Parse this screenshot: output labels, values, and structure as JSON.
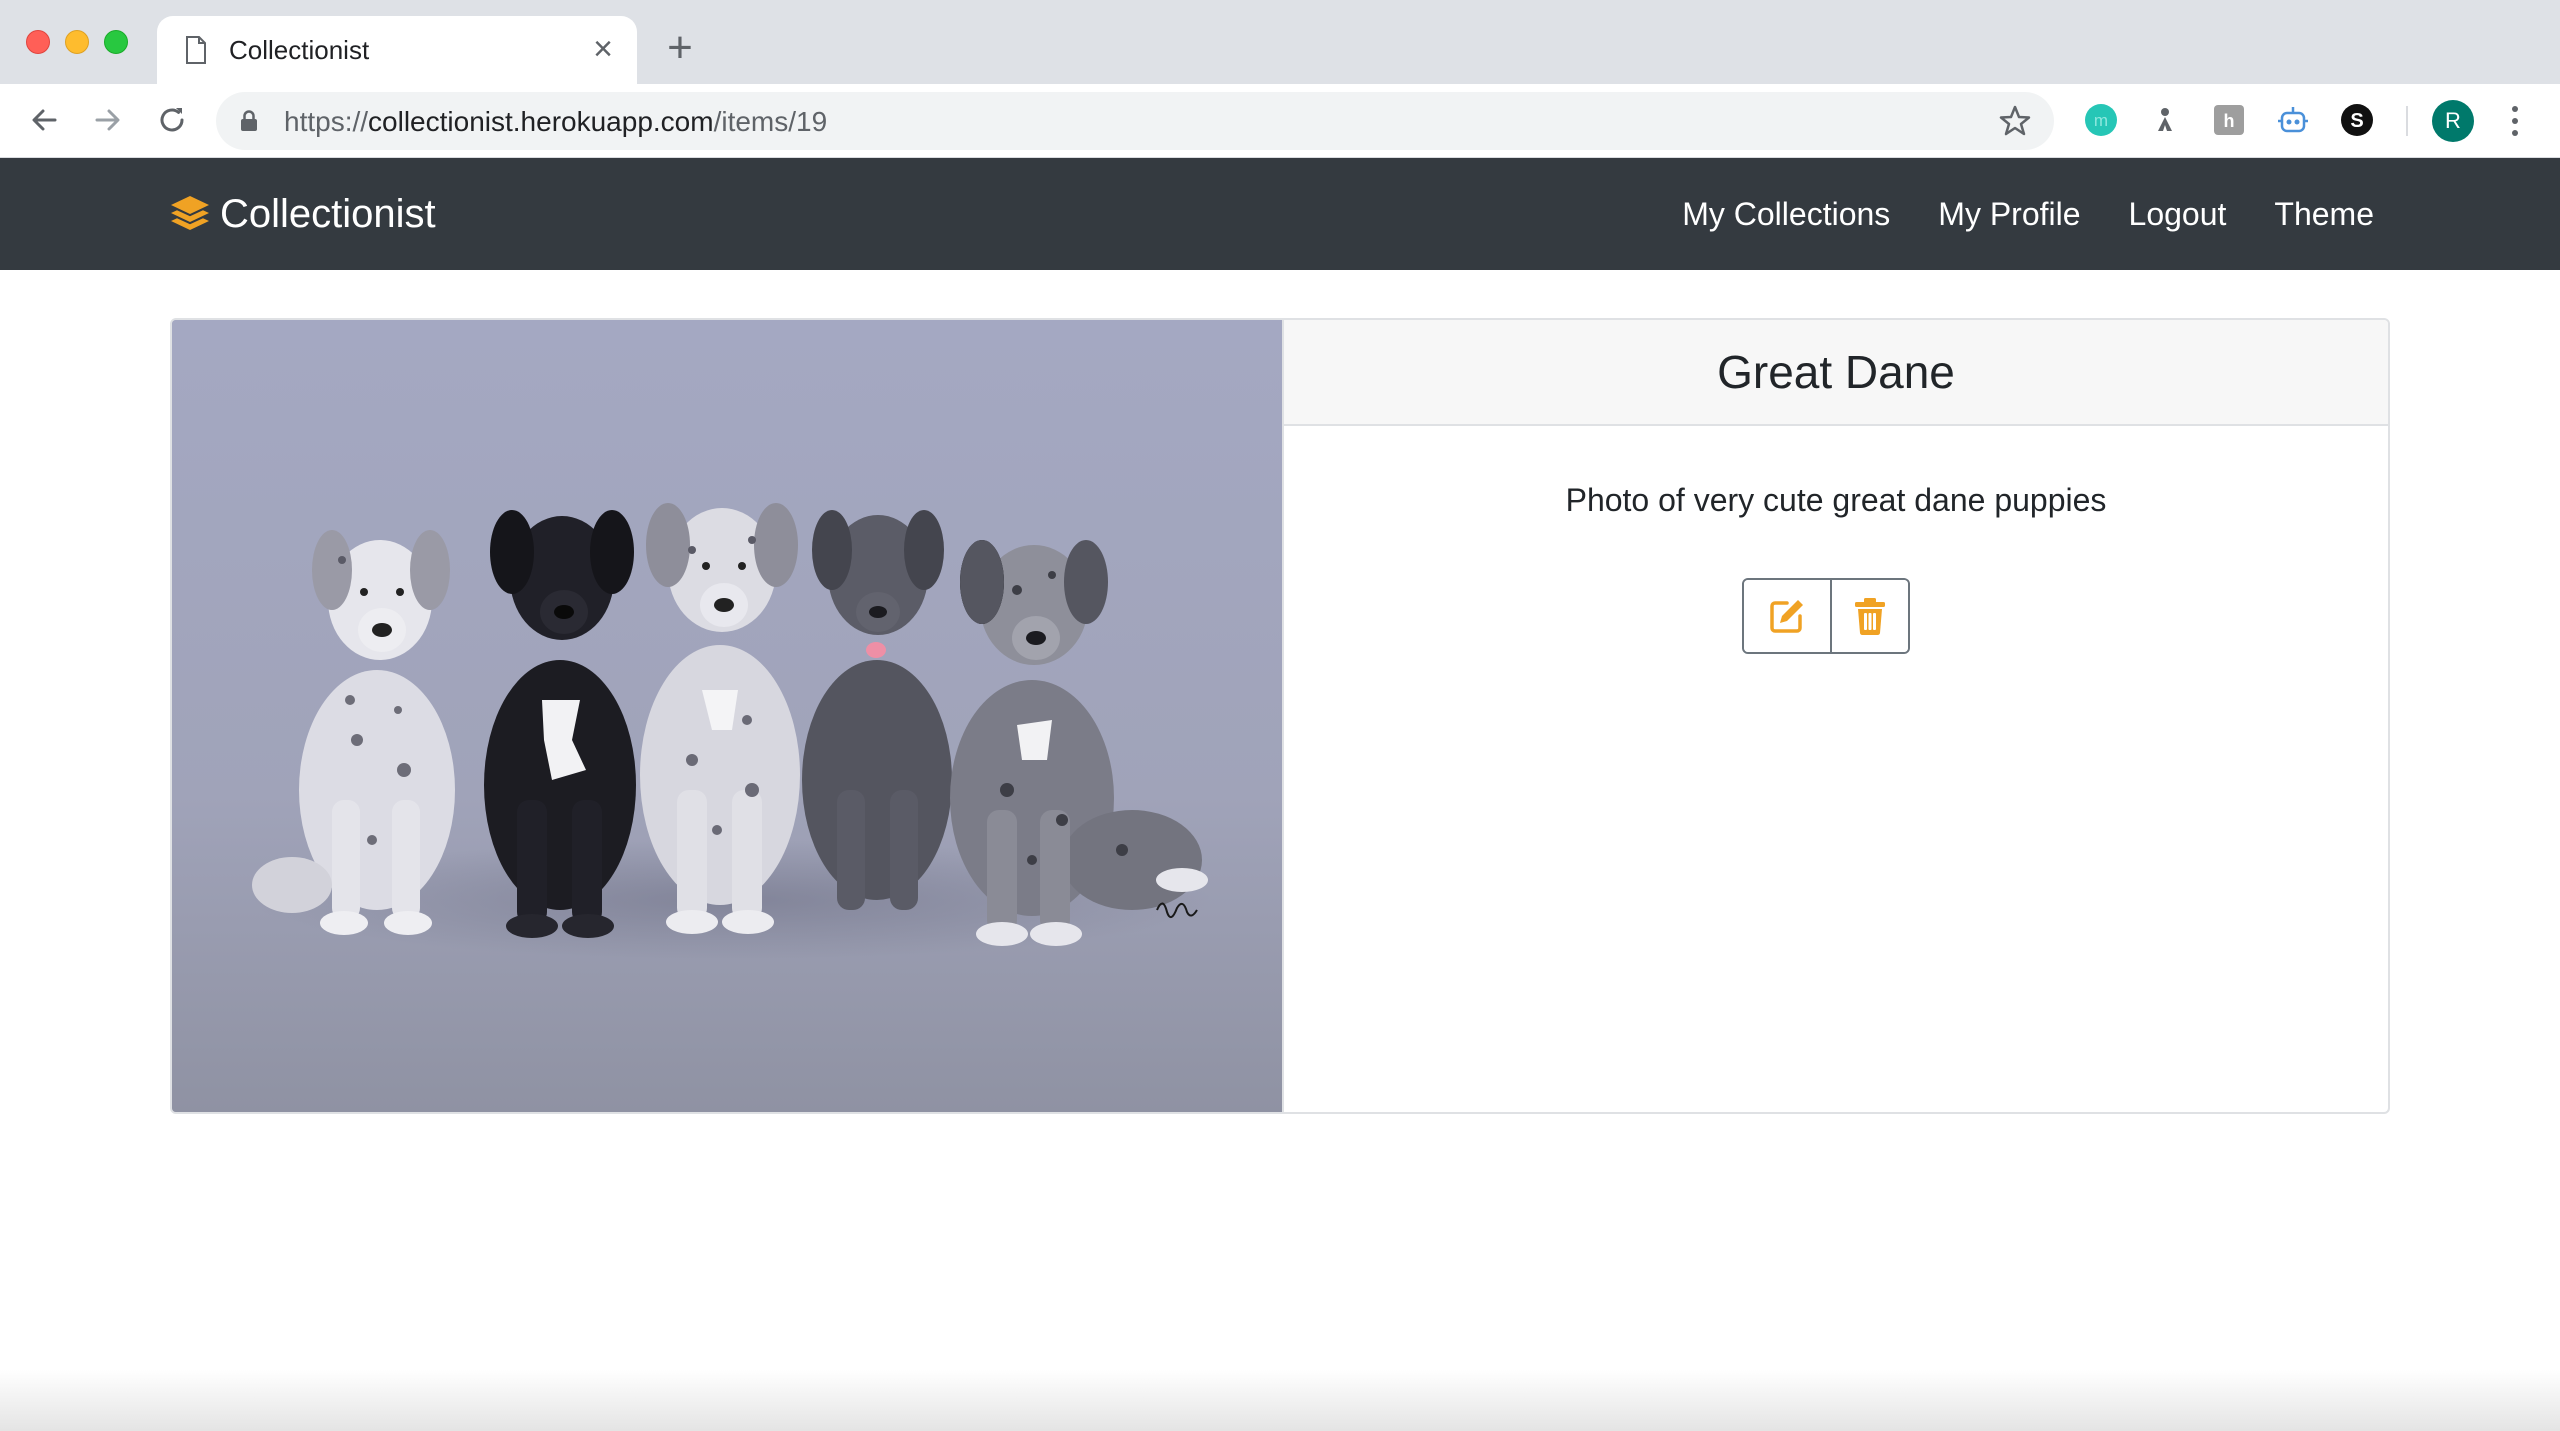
{
  "browser": {
    "tab_title": "Collectionist",
    "url_scheme": "https://",
    "url_host": "collectionist.herokuapp.com",
    "url_path": "/items/19",
    "profile_initial": "R"
  },
  "navbar": {
    "brand": "Collectionist",
    "links": [
      "My Collections",
      "My Profile",
      "Logout",
      "Theme"
    ]
  },
  "item": {
    "title": "Great Dane",
    "description": "Photo of very cute great dane puppies"
  },
  "colors": {
    "navbar_bg": "#343a40",
    "accent": "#f0a224",
    "border": "#dfe1e4"
  },
  "icons": {
    "brand": "layers-icon",
    "edit": "edit-icon",
    "delete": "trash-icon"
  }
}
